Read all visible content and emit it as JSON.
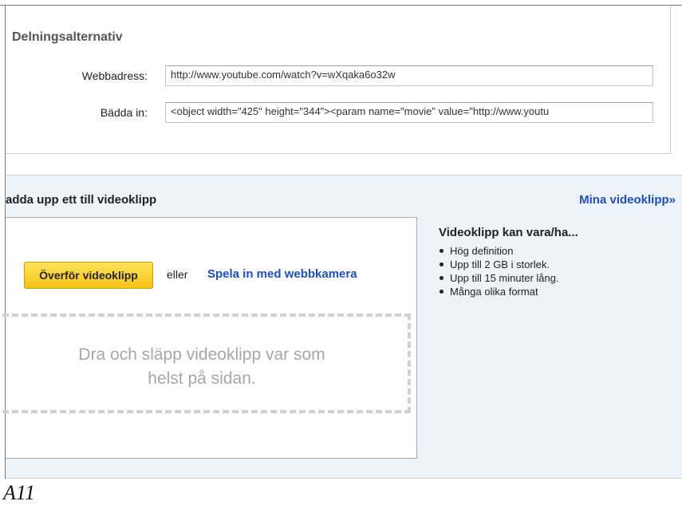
{
  "share": {
    "title": "Delningsalternativ",
    "url_label": "Webbadress:",
    "url_value": "http://www.youtube.com/watch?v=wXqaka6o32w",
    "embed_label": "Bädda in:",
    "embed_value": "<object width=\"425\" height=\"344\"><param name=\"movie\" value=\"http://www.youtu"
  },
  "upload": {
    "heading": "adda upp ett till videoklipp",
    "my_videos_link": "Mina videoklipp»",
    "upload_button": "Överför videoklipp",
    "or_text": "eller",
    "webcam_link": "Spela in med webbkamera",
    "drop_text_line1": "Dra och släpp videoklipp var som",
    "drop_text_line2": "helst på sidan."
  },
  "info": {
    "title": "Videoklipp kan vara/ha...",
    "items": [
      "Hög definition",
      "Upp till 2 GB i storlek.",
      "Upp till 15 minuter lång.",
      "Många olika format"
    ]
  },
  "footer": {
    "caption": "A11"
  }
}
